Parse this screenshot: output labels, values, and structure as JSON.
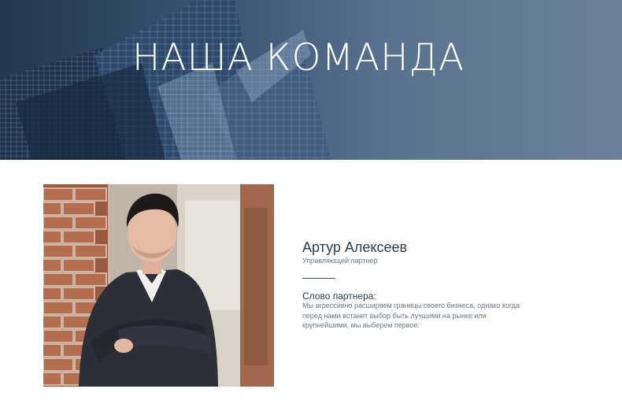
{
  "hero": {
    "title": "НАША КОМАНДА"
  },
  "member": {
    "name": "Артур Алексеев",
    "role": "Управляющий партнер",
    "quote_heading": "Слово партнера:",
    "quote_text": "Мы агрессивно расширяем границы своего бизнеса, однако когда перед нами встанет выбор быть лучшими на рынке или крупнейшими, мы выберем первое."
  },
  "colors": {
    "hero_overlay": "#3a5573",
    "heading_text": "#2c3d52",
    "body_text": "#6c7786",
    "divider": "#3b4e63"
  }
}
